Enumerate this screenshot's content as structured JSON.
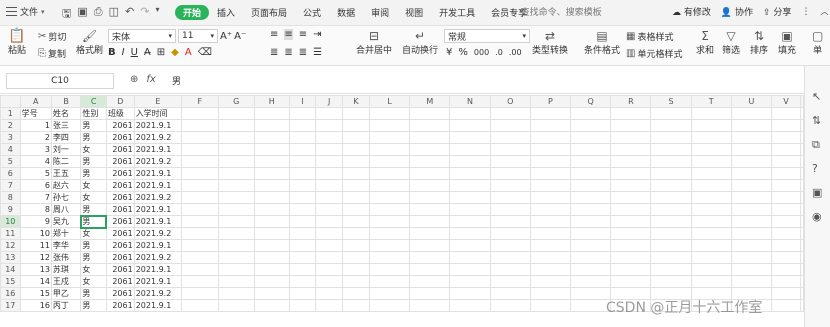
{
  "menubar": {
    "file_label": "文件",
    "tabs": [
      "开始",
      "插入",
      "页面布局",
      "公式",
      "数据",
      "审阅",
      "视图",
      "开发工具",
      "会员专享"
    ],
    "search_placeholder": "查找命令、搜索模板",
    "modified_label": "有修改",
    "collab_label": "协作",
    "share_label": "分享"
  },
  "ribbon": {
    "paste": "粘贴",
    "cut": "剪切",
    "copy": "复制",
    "format_painter": "格式刷",
    "font_name": "宋体",
    "font_size": "11",
    "merge_center": "合并居中",
    "wrap_text": "自动换行",
    "number_format": "常规",
    "type_convert": "类型转换",
    "conditional_format": "条件格式",
    "table_style": "表格样式",
    "cell_style": "单元格样式",
    "sum": "求和",
    "filter": "筛选",
    "sort": "排序",
    "fill": "填充",
    "single": "单"
  },
  "formula_bar": {
    "cell_ref": "C10",
    "value": "男"
  },
  "grid": {
    "columns": [
      "A",
      "B",
      "C",
      "D",
      "E",
      "F",
      "G",
      "H",
      "I",
      "J",
      "K",
      "L",
      "M",
      "N",
      "O",
      "P",
      "Q",
      "R",
      "S",
      "T",
      "U",
      "V"
    ],
    "rows": [
      [
        "学号",
        "姓名",
        "性别",
        "班级",
        "入学时间"
      ],
      [
        "1",
        "张三",
        "男",
        "2061",
        "2021.9.1"
      ],
      [
        "2",
        "李四",
        "男",
        "2061",
        "2021.9.2"
      ],
      [
        "3",
        "刘一",
        "女",
        "2061",
        "2021.9.1"
      ],
      [
        "4",
        "陈二",
        "男",
        "2061",
        "2021.9.2"
      ],
      [
        "5",
        "王五",
        "男",
        "2061",
        "2021.9.1"
      ],
      [
        "6",
        "赵六",
        "女",
        "2061",
        "2021.9.1"
      ],
      [
        "7",
        "孙七",
        "女",
        "2061",
        "2021.9.2"
      ],
      [
        "8",
        "周八",
        "男",
        "2061",
        "2021.9.1"
      ],
      [
        "9",
        "吴九",
        "男",
        "2061",
        "2021.9.1"
      ],
      [
        "10",
        "郑十",
        "女",
        "2061",
        "2021.9.2"
      ],
      [
        "11",
        "李华",
        "男",
        "2061",
        "2021.9.1"
      ],
      [
        "12",
        "张伟",
        "男",
        "2061",
        "2021.9.2"
      ],
      [
        "13",
        "苏琪",
        "女",
        "2061",
        "2021.9.1"
      ],
      [
        "14",
        "王戍",
        "女",
        "2061",
        "2021.9.1"
      ],
      [
        "15",
        "甲乙",
        "男",
        "2061",
        "2021.9.2"
      ],
      [
        "16",
        "丙丁",
        "男",
        "2061",
        "2021.9.1"
      ]
    ]
  },
  "watermark": "CSDN @正月十六工作室",
  "colors": {
    "accent": "#2bb35c"
  }
}
